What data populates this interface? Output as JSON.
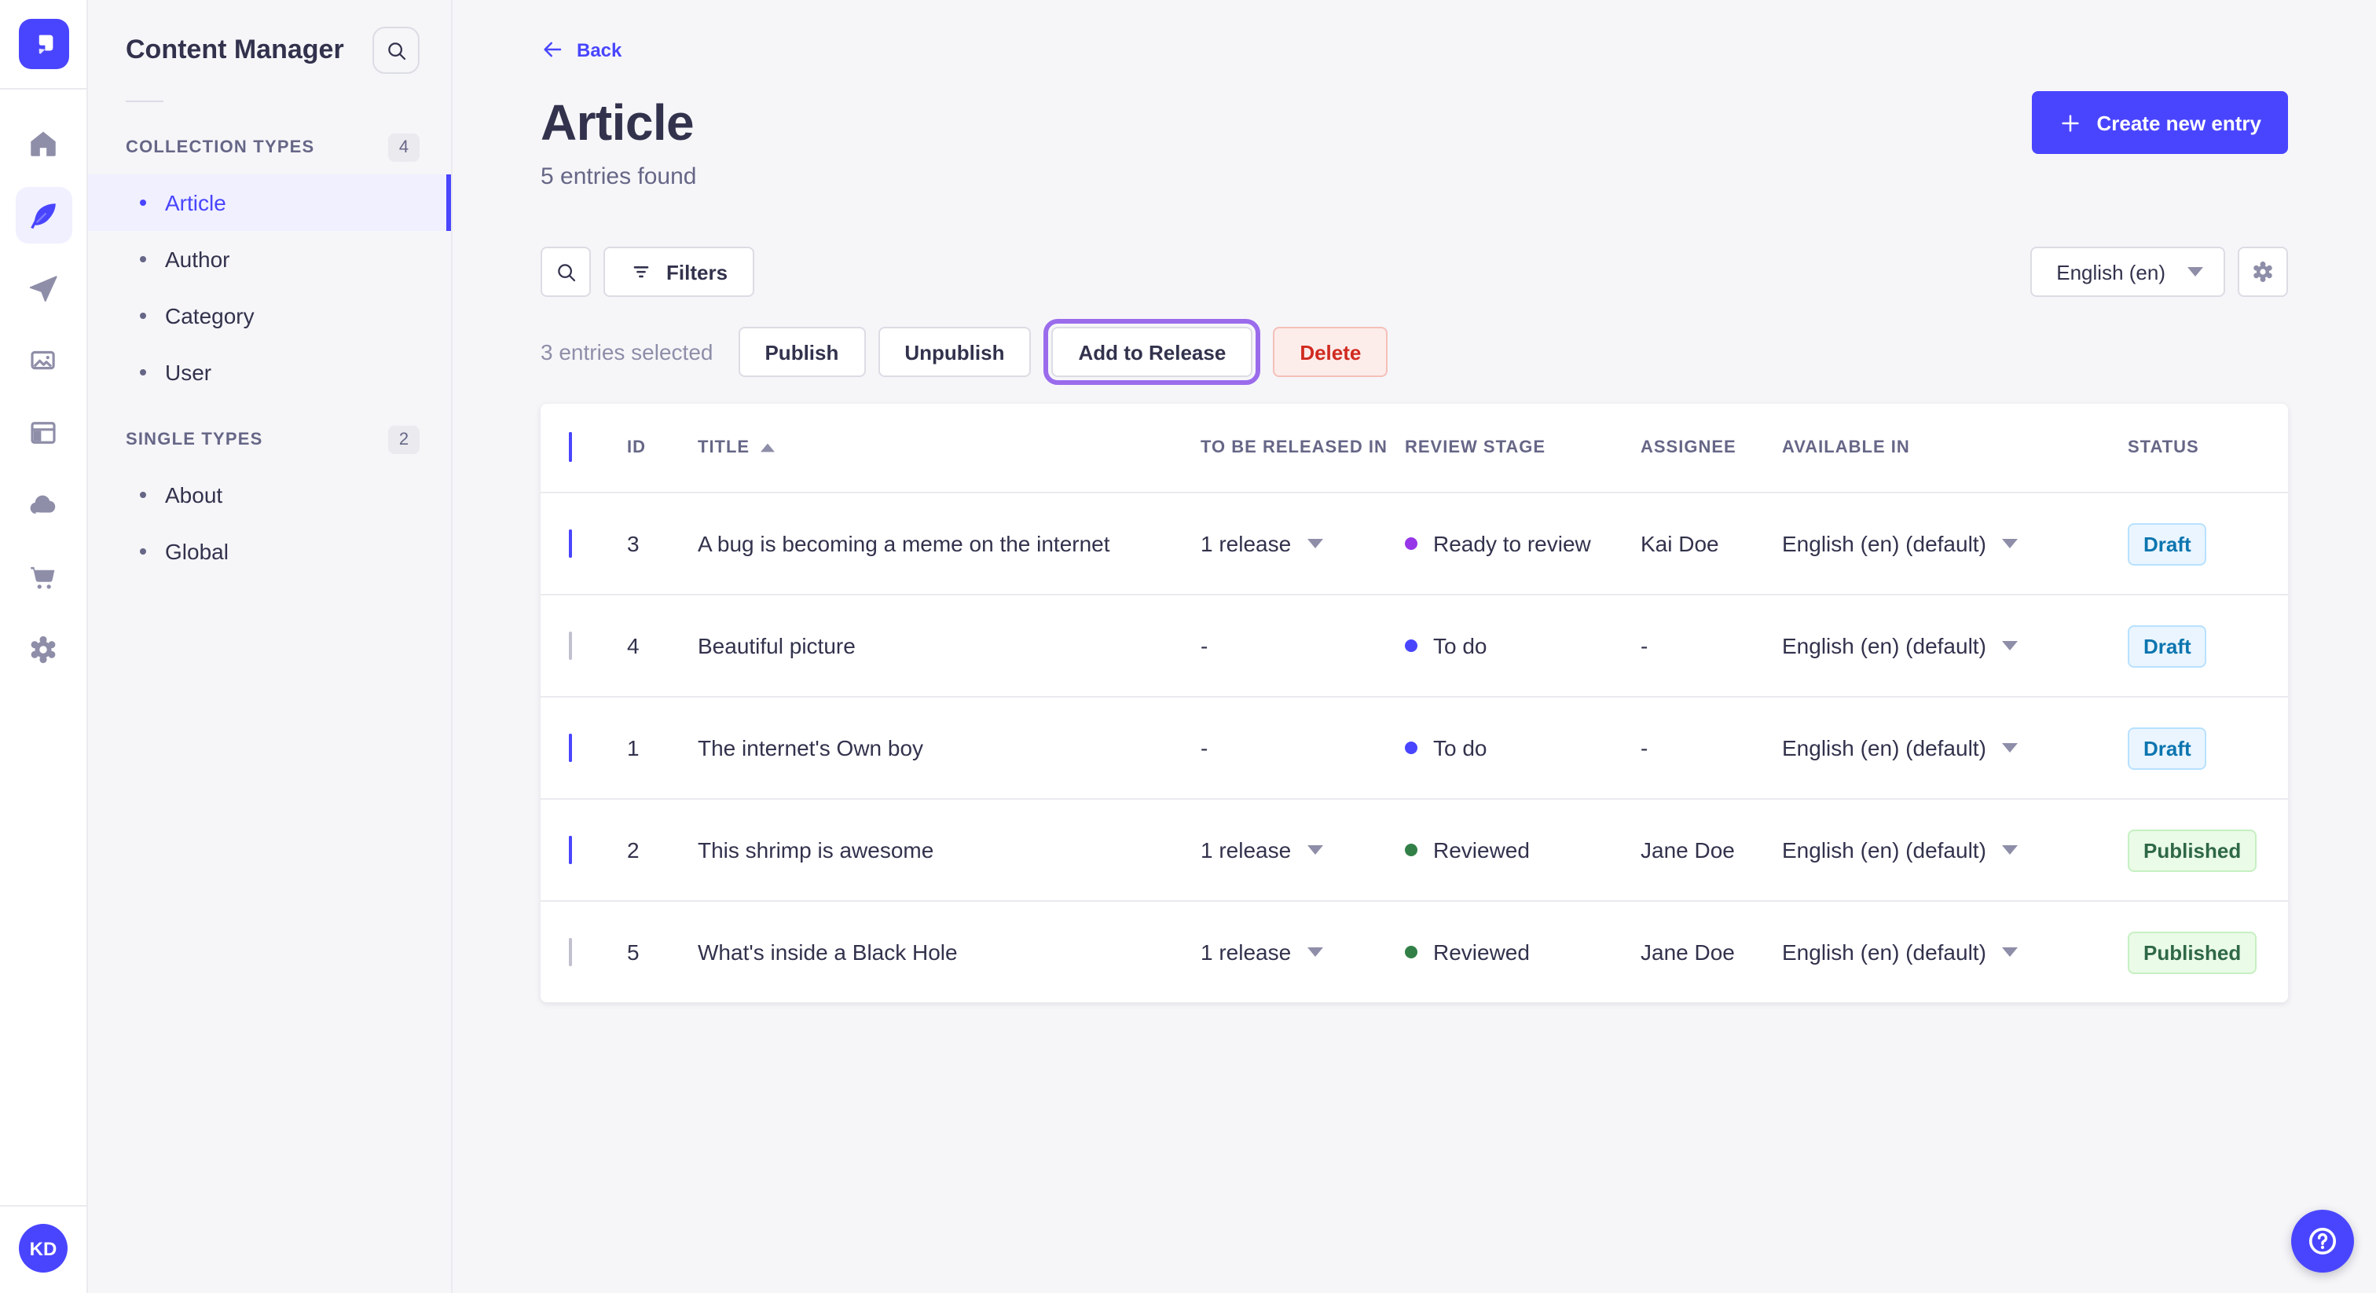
{
  "colors": {
    "primary": "#4945ff",
    "release_focus_ring": "#9a6cec",
    "delete_bg": "#fcecea",
    "delete_text": "#d02b20",
    "status_styles": {
      "Draft": {
        "bg": "#eaf5ff",
        "border": "#b8e1ff",
        "text": "#0c75af"
      },
      "Published": {
        "bg": "#eafbe7",
        "border": "#c6f0c2",
        "text": "#2f6846"
      }
    },
    "stage_colors": {
      "Ready to review": "#9736e8",
      "To do": "#4945ff",
      "Reviewed": "#328048"
    }
  },
  "icons": {
    "logo": "strapi-logo",
    "nav": [
      "home",
      "content-manager-feather",
      "releases-paper-plane",
      "media-library-images",
      "content-type-builder-layout",
      "cloud",
      "marketplace-cart",
      "settings-gear"
    ],
    "search": "magnifier",
    "filters": "funnel-lines",
    "caret": "triangle-down",
    "sort": "triangle-up",
    "back": "arrow-left",
    "create": "plus",
    "help": "question-mark-circle"
  },
  "user": {
    "initials": "KD"
  },
  "subnav": {
    "title": "Content Manager",
    "sections": [
      {
        "label": "COLLECTION TYPES",
        "count": "4",
        "items": [
          {
            "label": "Article",
            "active": true
          },
          {
            "label": "Author",
            "active": false
          },
          {
            "label": "Category",
            "active": false
          },
          {
            "label": "User",
            "active": false
          }
        ]
      },
      {
        "label": "SINGLE TYPES",
        "count": "2",
        "items": [
          {
            "label": "About",
            "active": false
          },
          {
            "label": "Global",
            "active": false
          }
        ]
      }
    ]
  },
  "header": {
    "back_label": "Back",
    "title": "Article",
    "subtitle": "5 entries found",
    "create_label": "Create new entry"
  },
  "toolbar": {
    "filters_label": "Filters",
    "locale": "English (en)"
  },
  "selection": {
    "text": "3 entries selected",
    "publish": "Publish",
    "unpublish": "Unpublish",
    "add_to_release": "Add to Release",
    "delete": "Delete"
  },
  "table": {
    "columns": [
      "ID",
      "TITLE",
      "TO BE RELEASED IN",
      "REVIEW STAGE",
      "ASSIGNEE",
      "AVAILABLE IN",
      "STATUS"
    ],
    "sort_column": "TITLE",
    "sort_direction": "asc",
    "header_checkbox_state": "indeterminate",
    "rows": [
      {
        "checked": true,
        "id": "3",
        "title": "A bug is becoming a meme on the internet",
        "release": "1 release",
        "review_stage": "Ready to review",
        "assignee": "Kai Doe",
        "available_in": "English (en) (default)",
        "status": "Draft"
      },
      {
        "checked": false,
        "id": "4",
        "title": "Beautiful picture",
        "release": "-",
        "review_stage": "To do",
        "assignee": "-",
        "available_in": "English (en) (default)",
        "status": "Draft"
      },
      {
        "checked": true,
        "id": "1",
        "title": "The internet's Own boy",
        "release": "-",
        "review_stage": "To do",
        "assignee": "-",
        "available_in": "English (en) (default)",
        "status": "Draft"
      },
      {
        "checked": true,
        "id": "2",
        "title": "This shrimp is awesome",
        "release": "1 release",
        "review_stage": "Reviewed",
        "assignee": "Jane Doe",
        "available_in": "English (en) (default)",
        "status": "Published"
      },
      {
        "checked": false,
        "id": "5",
        "title": "What's inside a Black Hole",
        "release": "1 release",
        "review_stage": "Reviewed",
        "assignee": "Jane Doe",
        "available_in": "English (en) (default)",
        "status": "Published"
      }
    ]
  }
}
